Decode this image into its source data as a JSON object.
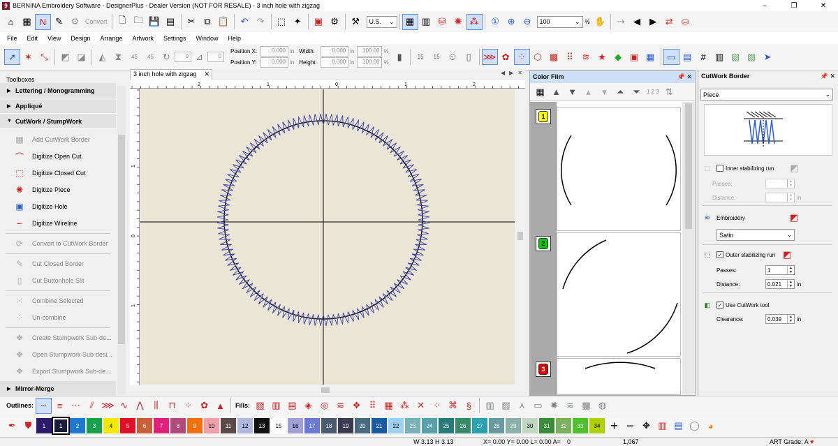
{
  "window": {
    "title": "BERNINA Embroidery Software - DesignerPlus - Dealer Version (NOT FOR RESALE) - 3 inch hole with zigzag",
    "logo_text": "9",
    "minimize_glyph": "–",
    "restore_glyph": "❐",
    "close_glyph": "✕"
  },
  "toolbar_main": {
    "convert_label": "Convert",
    "hoop_unit": "U.S.",
    "zoom_value": "100",
    "zoom_unit": "%"
  },
  "menu": [
    "File",
    "Edit",
    "View",
    "Design",
    "Arrange",
    "Artwork",
    "Settings",
    "Window",
    "Help"
  ],
  "property_bar": {
    "rotate_45_left": "45",
    "rotate_45_right": "45",
    "rotate_value": "0",
    "slant_value": "0",
    "position_x_label": "Position X:",
    "position_x_value": "0.000",
    "position_y_label": "Position Y:",
    "position_y_value": "0.000",
    "width_label": "Width:",
    "width_value": "0.000",
    "height_label": "Height:",
    "height_value": "0.000",
    "scale_w": "100.00",
    "scale_h": "100.00",
    "unit_in": "in",
    "unit_pct": "%",
    "size_15a": "15",
    "size_15b": "15"
  },
  "toolboxes": {
    "header": "Toolboxes",
    "groups": {
      "lettering": "Lettering / Monogramming",
      "applique": "Appliqué",
      "cutwork": "CutWork / StumpWork",
      "mirror": "Mirror-Merge"
    },
    "tools": [
      {
        "label": "Add CutWork Border",
        "icon": "cutwork-border-icon"
      },
      {
        "label": "Digitize Open Cut",
        "icon": "open-cut-icon"
      },
      {
        "label": "Digitize Closed Cut",
        "icon": "closed-cut-icon"
      },
      {
        "label": "Digitize Piece",
        "icon": "piece-icon"
      },
      {
        "label": "Digitize Hole",
        "icon": "hole-icon"
      },
      {
        "label": "Digitize Wireline",
        "icon": "wireline-icon"
      },
      {
        "label": "Convert to CutWork Border",
        "icon": "convert-border-icon"
      },
      {
        "label": "Cut Closed Border",
        "icon": "cut-border-icon"
      },
      {
        "label": "Cut Buttonhole Slit",
        "icon": "buttonhole-icon"
      },
      {
        "label": "Combine Selected",
        "icon": "combine-icon"
      },
      {
        "label": "Un-combine",
        "icon": "uncombine-icon"
      },
      {
        "label": "Create Stumpwork Sub-de...",
        "icon": "stumpwork-create-icon"
      },
      {
        "label": "Open Stumpwork Sub-desi...",
        "icon": "stumpwork-open-icon"
      },
      {
        "label": "Export Stumpwork Sub-de...",
        "icon": "stumpwork-export-icon"
      }
    ]
  },
  "document": {
    "tab": "3 inch hole with zigzag",
    "close_glyph": "✕",
    "ruler_labels": [
      "2",
      "1",
      "0",
      "1",
      "2"
    ],
    "ruler_left_labels": [
      "1",
      "0",
      "1"
    ]
  },
  "color_film": {
    "title": "Color Film",
    "pin_glyph": "📌 ✕",
    "order_label": "1 2 3",
    "items": [
      {
        "num": "1",
        "color": "#ffff00"
      },
      {
        "num": "2",
        "color": "#00cc00"
      },
      {
        "num": "3",
        "color": "#e00000"
      }
    ]
  },
  "cutwork_border": {
    "title": "CutWork Border",
    "pin_glyph": "📌 ✕",
    "type_value": "Piece",
    "inner_run_label": "Inner stabilizing run",
    "passes_label": "Passes:",
    "distance_label": "Distance:",
    "inner_unit": "in",
    "embroidery_label": "Embroidery",
    "embroidery_type": "Satin",
    "outer_run_label": "Outer stabilizing run",
    "outer_passes_label": "Passes:",
    "outer_passes_value": "1",
    "outer_distance_label": "Distance:",
    "outer_distance_value": "0.021",
    "outer_unit": "in",
    "use_tool_label": "Use CutWork tool",
    "clearance_label": "Clearance:",
    "clearance_value": "0.039",
    "clearance_unit": "in"
  },
  "outlines": {
    "outlines_label": "Outlines:",
    "fills_label": "Fills:"
  },
  "palette": {
    "colors": [
      {
        "n": "1",
        "c": "#2b1a6b"
      },
      {
        "n": "1",
        "c": "#1a1a3a"
      },
      {
        "n": "2",
        "c": "#1f77d0"
      },
      {
        "n": "3",
        "c": "#18a04a"
      },
      {
        "n": "4",
        "c": "#f2e800"
      },
      {
        "n": "5",
        "c": "#e0102a"
      },
      {
        "n": "6",
        "c": "#c8603a"
      },
      {
        "n": "7",
        "c": "#e0207a"
      },
      {
        "n": "8",
        "c": "#b04a78"
      },
      {
        "n": "9",
        "c": "#f07010"
      },
      {
        "n": "10",
        "c": "#f0a0a8"
      },
      {
        "n": "11",
        "c": "#5a4a4a"
      },
      {
        "n": "12",
        "c": "#b0b8e0"
      },
      {
        "n": "13",
        "c": "#101010"
      },
      {
        "n": "15",
        "c": "#ffffff"
      },
      {
        "n": "16",
        "c": "#a0a0d8"
      },
      {
        "n": "17",
        "c": "#6a7ad0"
      },
      {
        "n": "18",
        "c": "#4a5a70"
      },
      {
        "n": "19",
        "c": "#3a3a50"
      },
      {
        "n": "20",
        "c": "#4a6a80"
      },
      {
        "n": "21",
        "c": "#1a5aa0"
      },
      {
        "n": "22",
        "c": "#a0d0f0"
      },
      {
        "n": "23",
        "c": "#7ab0b8"
      },
      {
        "n": "24",
        "c": "#5aa0a8"
      },
      {
        "n": "25",
        "c": "#2a7a7a"
      },
      {
        "n": "26",
        "c": "#3a8a6a"
      },
      {
        "n": "27",
        "c": "#2aa0b0"
      },
      {
        "n": "28",
        "c": "#6a9aa0"
      },
      {
        "n": "29",
        "c": "#8ab0a8"
      },
      {
        "n": "30",
        "c": "#c0d8c0"
      },
      {
        "n": "31",
        "c": "#3a8a3a"
      },
      {
        "n": "32",
        "c": "#7ab060"
      },
      {
        "n": "33",
        "c": "#50c030"
      },
      {
        "n": "34",
        "c": "#b0d000"
      }
    ]
  },
  "status": {
    "size": "W 3.13 H 3.13",
    "coords": "X= 0.00 Y= 0.00 L= 0.00 A=",
    "angle": "0",
    "stitches": "1,067",
    "art_grade": "ART Grade: A",
    "heart": "♥"
  },
  "colors": {
    "accent_blue": "#2b5bd7",
    "stitch": "#4a4ab0",
    "canvas": "#e9e6d6",
    "red_tool": "#d22"
  }
}
